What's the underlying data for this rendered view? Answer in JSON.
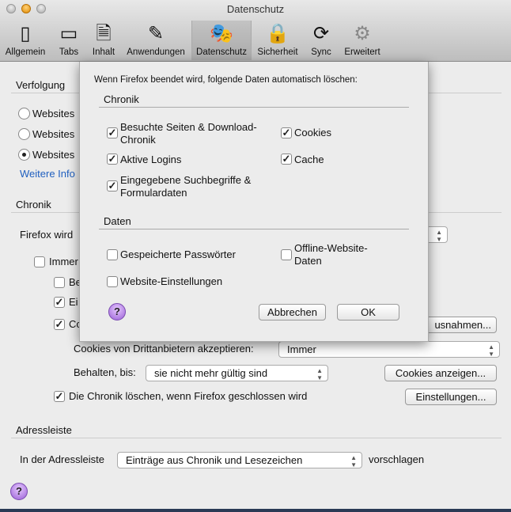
{
  "window": {
    "title": "Datenschutz"
  },
  "toolbar": [
    {
      "label": "Allgemein",
      "icon": "switch-icon"
    },
    {
      "label": "Tabs",
      "icon": "tabs-icon"
    },
    {
      "label": "Inhalt",
      "icon": "content-icon"
    },
    {
      "label": "Anwendungen",
      "icon": "applications-icon"
    },
    {
      "label": "Datenschutz",
      "icon": "mask-icon",
      "selected": true
    },
    {
      "label": "Sicherheit",
      "icon": "lock-icon"
    },
    {
      "label": "Sync",
      "icon": "sync-icon"
    },
    {
      "label": "Erweitert",
      "icon": "gear-icon"
    }
  ],
  "background": {
    "tracking_heading": "Verfolgung",
    "radios": [
      {
        "label": "Websites",
        "checked": false
      },
      {
        "label": "Websites",
        "checked": false
      },
      {
        "label": "Websites",
        "checked": true
      }
    ],
    "more_info": "Weitere Info",
    "history_heading": "Chronik",
    "firefox_will": "Firefox wird",
    "always": "Immer",
    "be": "Be",
    "ei": "Ei",
    "co": "Co",
    "exceptions_button": "usnahmen...",
    "third_party_label": "Cookies von Drittanbietern akzeptieren:",
    "third_party_value": "Immer",
    "keep_until_label": "Behalten, bis:",
    "keep_until_value": "sie nicht mehr gültig sind",
    "show_cookies_button": "Cookies anzeigen...",
    "clear_history_label": "Die Chronik löschen, wenn Firefox geschlossen wird",
    "settings_button": "Einstellungen...",
    "address_heading": "Adressleiste",
    "address_label": "In der Adressleiste",
    "address_value": "Einträge aus Chronik und Lesezeichen",
    "suggest": "vorschlagen"
  },
  "sheet": {
    "intro": "Wenn Firefox beendet wird, folgende Daten automatisch löschen:",
    "history_heading": "Chronik",
    "history_items": [
      {
        "label": "Besuchte Seiten & Download-Chronik",
        "checked": true
      },
      {
        "label": "Cookies",
        "checked": true
      },
      {
        "label": "Aktive Logins",
        "checked": true
      },
      {
        "label": "Cache",
        "checked": true
      },
      {
        "label": "Eingegebene Suchbegriffe & Formulardaten",
        "checked": true
      }
    ],
    "data_heading": "Daten",
    "data_items": [
      {
        "label": "Gespeicherte Passwörter",
        "checked": false
      },
      {
        "label": "Offline-Website-Daten",
        "checked": false
      },
      {
        "label": "Website-Einstellungen",
        "checked": false
      }
    ],
    "cancel": "Abbrechen",
    "ok": "OK"
  }
}
